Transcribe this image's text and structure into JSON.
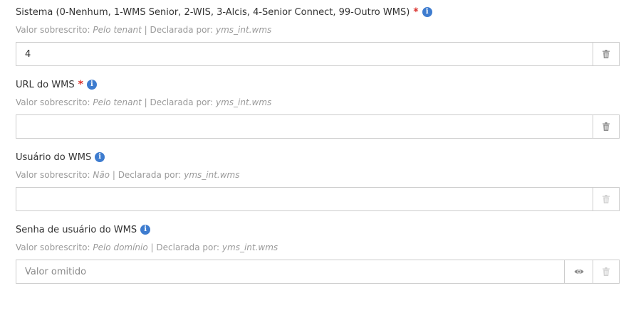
{
  "colors": {
    "required": "#d9302c",
    "info": "#3e7ccf",
    "muted": "#9a9a9a",
    "border": "#cccccc"
  },
  "fields": [
    {
      "label": "Sistema (0-Nenhum, 1-WMS Senior, 2-WIS, 3-Alcis, 4-Senior Connect, 99-Outro WMS)",
      "required_mark": "*",
      "info_icon": "i",
      "meta_prefix": "Valor sobrescrito: ",
      "meta_override": "Pelo tenant",
      "meta_sep": " | Declarada por: ",
      "meta_declared": "yms_int.wms",
      "value": "4",
      "placeholder": "",
      "delete_enabled": true
    },
    {
      "label": "URL do WMS",
      "required_mark": "*",
      "info_icon": "i",
      "meta_prefix": "Valor sobrescrito: ",
      "meta_override": "Pelo tenant",
      "meta_sep": " | Declarada por: ",
      "meta_declared": "yms_int.wms",
      "value": "",
      "placeholder": "",
      "delete_enabled": true
    },
    {
      "label": "Usuário do WMS",
      "info_icon": "i",
      "meta_prefix": "Valor sobrescrito: ",
      "meta_override": "Não",
      "meta_sep": " | Declarada por: ",
      "meta_declared": "yms_int.wms",
      "value": "",
      "placeholder": "",
      "delete_enabled": false
    },
    {
      "label": "Senha de usuário do WMS",
      "info_icon": "i",
      "meta_prefix": "Valor sobrescrito: ",
      "meta_override": "Pelo domínio",
      "meta_sep": " | Declarada por: ",
      "meta_declared": "yms_int.wms",
      "value": "",
      "placeholder": "Valor omitido",
      "delete_enabled": false
    }
  ]
}
